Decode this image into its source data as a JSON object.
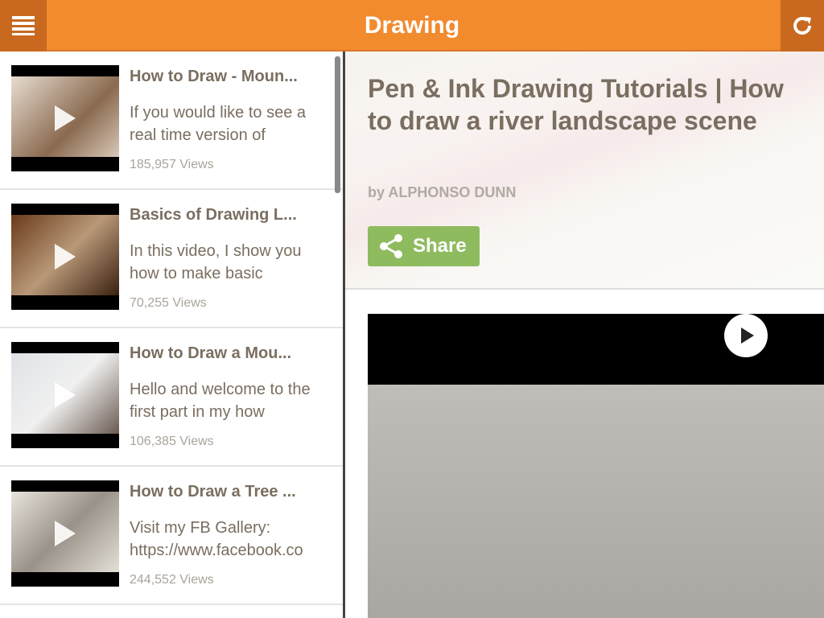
{
  "header": {
    "title": "Drawing",
    "menu_icon": "hamburger-menu-icon",
    "refresh_icon": "refresh-icon",
    "color": "#f28a2e"
  },
  "videos": [
    {
      "title": "How to Draw - Moun...",
      "description": "If you would like to see a real time version of",
      "views": "185,957 Views"
    },
    {
      "title": "Basics of Drawing L...",
      "description": "In this video, I show you how to make basic",
      "views": "70,255 Views"
    },
    {
      "title": "How to Draw a Mou...",
      "description": "Hello and welcome to the first part in my how",
      "views": "106,385 Views"
    },
    {
      "title": "How to Draw a Tree ...",
      "description": "Visit my FB Gallery: https://www.facebook.co",
      "views": "244,552 Views"
    }
  ],
  "detail": {
    "title": "Pen & Ink Drawing Tutorials | How to draw a river landscape scene",
    "byline": "by ALPHONSO DUNN",
    "share_label": "Share",
    "share_color": "#8fbb5f"
  }
}
